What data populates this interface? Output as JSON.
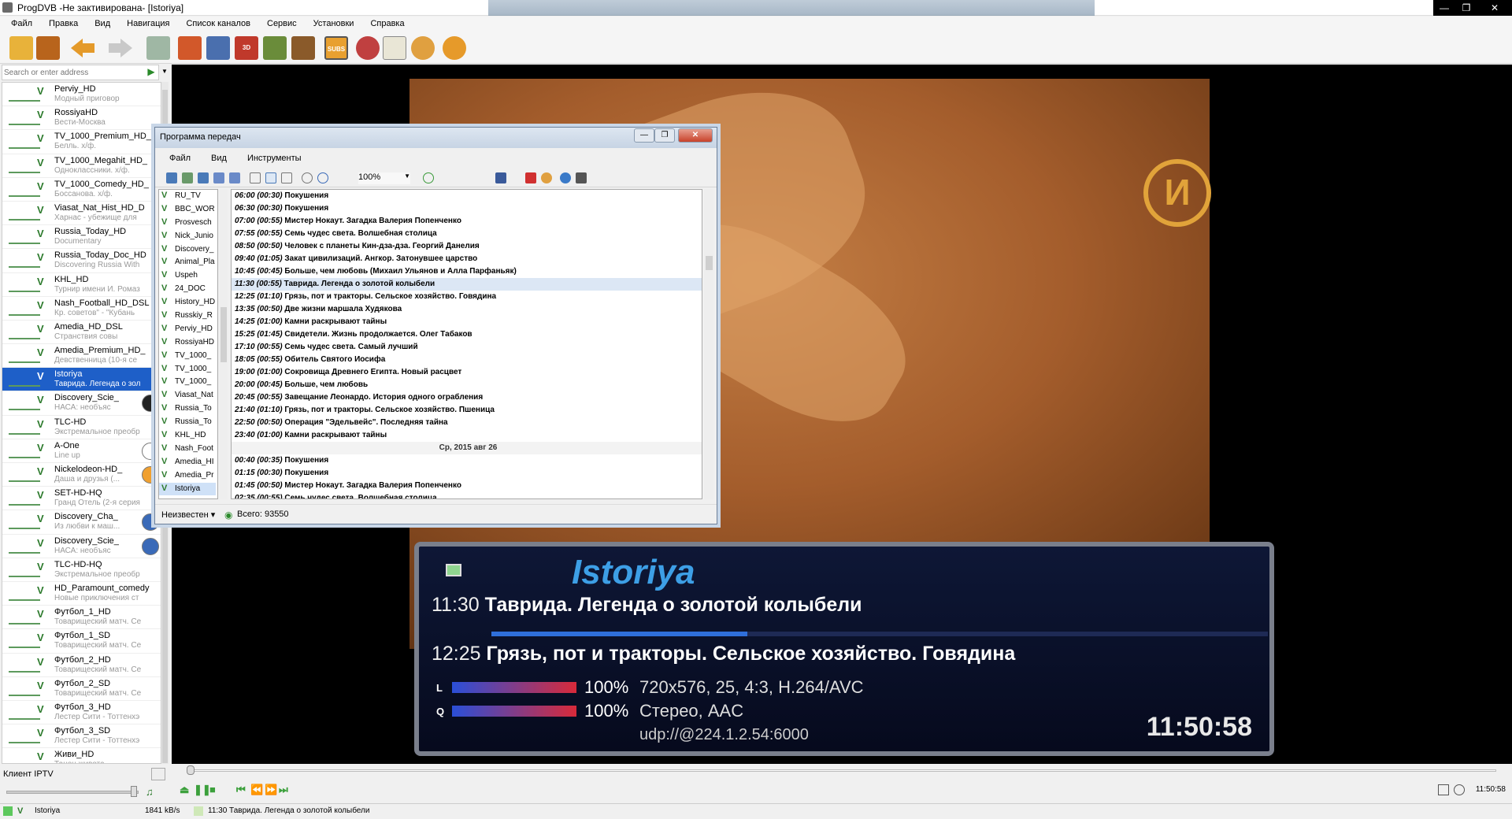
{
  "window": {
    "title": "ProgDVB -Не зактивирована- [Istoriya]",
    "min": "—",
    "max": "❐",
    "close": "✕"
  },
  "menu": [
    "Файл",
    "Правка",
    "Вид",
    "Навигация",
    "Список каналов",
    "Сервис",
    "Установки",
    "Справка"
  ],
  "search": {
    "placeholder": "Search or enter address",
    "go": "▶",
    "drop": "▼"
  },
  "channels": [
    {
      "name": "Perviy_HD",
      "program": "Модный приговор"
    },
    {
      "name": "RossiyaHD",
      "program": "Вести-Москва"
    },
    {
      "name": "TV_1000_Premium_HD_",
      "program": "Белль. х/ф."
    },
    {
      "name": "TV_1000_Megahit_HD_",
      "program": "Одноклассники. х/ф."
    },
    {
      "name": "TV_1000_Comedy_HD_",
      "program": "Боссанова. х/ф."
    },
    {
      "name": "Viasat_Nat_Hist_HD_D",
      "program": "Харнас - убежище для"
    },
    {
      "name": "Russia_Today_HD",
      "program": "Documentary"
    },
    {
      "name": "Russia_Today_Doc_HD",
      "program": "Discovering Russia With"
    },
    {
      "name": "KHL_HD",
      "program": "Турнир имени И. Ромаз"
    },
    {
      "name": "Nash_Football_HD_DSL",
      "program": "Кр. советов\" - \"Кубань"
    },
    {
      "name": "Amedia_HD_DSL",
      "program": "Странствия совы"
    },
    {
      "name": "Amedia_Premium_HD_",
      "program": "Девственница (10-я се"
    },
    {
      "name": "Istoriya",
      "program": "Таврида. Легенда о зол"
    },
    {
      "name": "Discovery_Scie_",
      "program": "НАСА: необъяс"
    },
    {
      "name": "TLC-HD",
      "program": "Экстремальное преобр"
    },
    {
      "name": "A-One",
      "program": "Line up"
    },
    {
      "name": "Nickelodeon-HD_",
      "program": "Даша и друзья (..."
    },
    {
      "name": "SET-HD-HQ",
      "program": "Гранд Отель (2-я серия"
    },
    {
      "name": "Discovery_Cha_",
      "program": "Из любви к маш..."
    },
    {
      "name": "Discovery_Scie_",
      "program": "НАСА: необъяс"
    },
    {
      "name": "TLC-HD-HQ",
      "program": "Экстремальное преобр"
    },
    {
      "name": "HD_Paramount_comedy",
      "program": "Новые приключения ст"
    },
    {
      "name": "Футбол_1_HD",
      "program": "Товарищеский матч. Се"
    },
    {
      "name": "Футбол_1_SD",
      "program": "Товарищеский матч. Се"
    },
    {
      "name": "Футбол_2_HD",
      "program": "Товарищеский матч. Се"
    },
    {
      "name": "Футбол_2_SD",
      "program": "Товарищеский матч. Се"
    },
    {
      "name": "Футбол_3_HD",
      "program": "Лестер Сити - Тоттенхэ"
    },
    {
      "name": "Футбол_3_SD",
      "program": "Лестер Сити - Тоттенхэ"
    },
    {
      "name": "Живи_HD",
      "program": "Танец живота"
    }
  ],
  "left_footer": {
    "iptv": "Клиент IPTV"
  },
  "epg": {
    "title": "Программа передач",
    "menu": [
      "Файл",
      "Вид",
      "Инструменты"
    ],
    "zoom": "100%",
    "channels": [
      "RU_TV",
      "BBC_WOR",
      "Prosvesch",
      "Nick_Junio",
      "Discovery_",
      "Animal_Pla",
      "Uspeh",
      "24_DOC",
      "History_HD",
      "Russkiy_R",
      "Perviy_HD",
      "RossiyaHD",
      "TV_1000_",
      "TV_1000_",
      "TV_1000_",
      "Viasat_Nat",
      "Russia_To",
      "Russia_To",
      "KHL_HD",
      "Nash_Foot",
      "Amedia_HI",
      "Amedia_Pr",
      "Istoriya"
    ],
    "programs": [
      {
        "t": "06:00 (00:30)",
        "d": "Покушения"
      },
      {
        "t": "06:30 (00:30)",
        "d": "Покушения"
      },
      {
        "t": "07:00 (00:55)",
        "d": "Мистер Нокаут. Загадка Валерия Попенченко"
      },
      {
        "t": "07:55 (00:55)",
        "d": "Семь чудес света. Волшебная столица"
      },
      {
        "t": "08:50 (00:50)",
        "d": "Человек с планеты Кин-дза-дза. Георгий Данелия"
      },
      {
        "t": "09:40 (01:05)",
        "d": "Закат цивилизаций. Ангкор. Затонувшее царство"
      },
      {
        "t": "10:45 (00:45)",
        "d": "Больше, чем любовь (Михаил Ульянов и Алла Парфаньяк)"
      },
      {
        "t": "11:30 (00:55)",
        "d": "Таврида. Легенда о золотой колыбели",
        "sel": true
      },
      {
        "t": "12:25 (01:10)",
        "d": "Грязь, пот и тракторы. Сельское хозяйство. Говядина"
      },
      {
        "t": "13:35 (00:50)",
        "d": "Две жизни маршала Худякова"
      },
      {
        "t": "14:25 (01:00)",
        "d": "Камни раскрывают тайны"
      },
      {
        "t": "15:25 (01:45)",
        "d": "Свидетели. Жизнь продолжается. Олег Табаков"
      },
      {
        "t": "17:10 (00:55)",
        "d": "Семь чудес света. Самый лучший"
      },
      {
        "t": "18:05 (00:55)",
        "d": "Обитель Святого Иосифа"
      },
      {
        "t": "19:00 (01:00)",
        "d": "Сокровища Древнего Египта. Новый расцвет"
      },
      {
        "t": "20:00 (00:45)",
        "d": "Больше, чем любовь"
      },
      {
        "t": "20:45 (00:55)",
        "d": "Завещание Леонардо. История одного ограбления"
      },
      {
        "t": "21:40 (01:10)",
        "d": "Грязь, пот и тракторы. Сельское хозяйство. Пшеница"
      },
      {
        "t": "22:50 (00:50)",
        "d": "Операция \"Эдельвейс\". Последняя тайна"
      },
      {
        "t": "23:40 (01:00)",
        "d": "Камни раскрывают тайны"
      },
      {
        "day": "Ср, 2015 авг 26"
      },
      {
        "t": "00:40 (00:35)",
        "d": "Покушения"
      },
      {
        "t": "01:15 (00:30)",
        "d": "Покушения"
      },
      {
        "t": "01:45 (00:50)",
        "d": "Мистер Нокаут. Загадка Валерия Попенченко"
      },
      {
        "t": "02:35 (00:55)",
        "d": "Семь чудес света. Волшебная столица"
      }
    ],
    "status": {
      "filter": "Неизвестен ▾",
      "total": "Всего: 93550"
    }
  },
  "osd": {
    "channel": "Istoriya",
    "now_time": "11:30",
    "now_title": "Таврида. Легенда о золотой колыбели",
    "next_time": "12:25",
    "next_title": "Грязь, пот и тракторы. Сельское хозяйство. Говядина",
    "progress": 0.33,
    "l_label": "L",
    "l_pct": "100%",
    "video_info": "720x576, 25, 4:3, H.264/AVC",
    "q_label": "Q",
    "q_pct": "100%",
    "audio_info": "Стерео, AAC",
    "url": "udp://@224.1.2.54:6000",
    "clock": "11:50:58"
  },
  "video": {
    "logo": "И"
  },
  "controls": {
    "time": "11:50:58"
  },
  "statusbar": {
    "channel": "Istoriya",
    "rate": "1841 kB/s",
    "program": "11:30 Таврида. Легенда о золотой колыбели"
  }
}
